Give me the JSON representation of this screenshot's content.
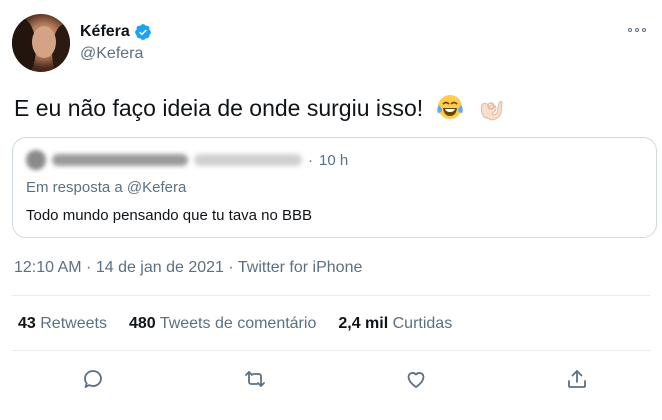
{
  "author": {
    "display_name": "Kéfera",
    "handle": "@Kefera",
    "verified": true
  },
  "tweet": {
    "text": "E eu não faço ideia de onde surgiu isso!",
    "emojis": [
      "face-with-tears-of-joy",
      "ok-hand"
    ]
  },
  "quoted": {
    "time": "10 h",
    "reply_to": "Em resposta a @Kefera",
    "text": "Todo mundo pensando que tu tava no BBB"
  },
  "meta": {
    "line": "12:10 AM · 14 de jan de 2021 · Twitter for iPhone"
  },
  "stats": [
    {
      "count": "43",
      "label": "Retweets"
    },
    {
      "count": "480",
      "label": "Tweets de comentário"
    },
    {
      "count": "2,4 mil",
      "label": "Curtidas"
    }
  ],
  "actions": [
    "reply-icon",
    "retweet-icon",
    "like-icon",
    "share-icon"
  ],
  "colors": {
    "text": "#0f1419",
    "secondary": "#5b7083",
    "verified": "#1da1f2",
    "border": "#cfd9de"
  }
}
